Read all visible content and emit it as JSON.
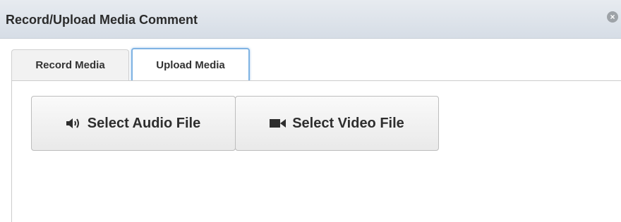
{
  "dialog": {
    "title": "Record/Upload Media Comment",
    "close_icon": "close-icon"
  },
  "tabs": [
    {
      "label": "Record Media",
      "active": false
    },
    {
      "label": "Upload Media",
      "active": true
    }
  ],
  "upload": {
    "audio_button": {
      "label": "Select Audio File",
      "icon": "speaker-icon"
    },
    "video_button": {
      "label": "Select Video File",
      "icon": "video-camera-icon"
    }
  },
  "colors": {
    "titlebar": "#dde3ea",
    "active_tab_border": "#7fb3e3",
    "button_border": "#bdbdbd"
  }
}
